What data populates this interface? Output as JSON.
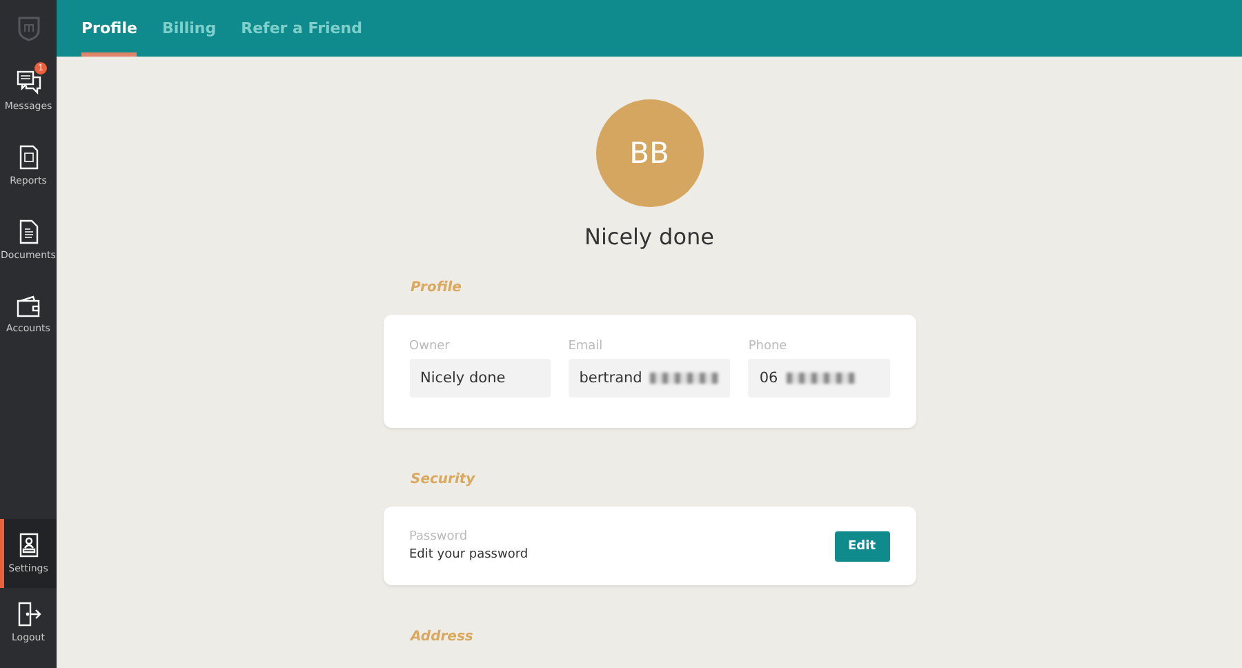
{
  "sidebar": {
    "items": [
      {
        "label": "Messages",
        "badge": "1",
        "selected": false
      },
      {
        "label": "Reports",
        "selected": false
      },
      {
        "label": "Documents",
        "selected": false
      },
      {
        "label": "Accounts",
        "selected": false
      },
      {
        "label": "Settings",
        "selected": true
      },
      {
        "label": "Logout",
        "selected": false
      }
    ]
  },
  "tabs": [
    {
      "label": "Profile",
      "selected": true
    },
    {
      "label": "Billing",
      "selected": false
    },
    {
      "label": "Refer a Friend",
      "selected": false
    }
  ],
  "avatar": {
    "initials": "BB"
  },
  "profile_name": "Nicely done",
  "sections": [
    {
      "kind": "fields",
      "title": "Profile",
      "fields": [
        {
          "label": "Owner",
          "value": "Nicely done",
          "redacted": false
        },
        {
          "label": "Email",
          "value": "bertrand",
          "redacted": true
        },
        {
          "label": "Phone",
          "value": "06",
          "redacted": true
        }
      ]
    },
    {
      "kind": "action",
      "title": "Security",
      "label": "Password",
      "text": "Edit your password",
      "button": "Edit"
    },
    {
      "kind": "heading",
      "title": "Address"
    }
  ]
}
